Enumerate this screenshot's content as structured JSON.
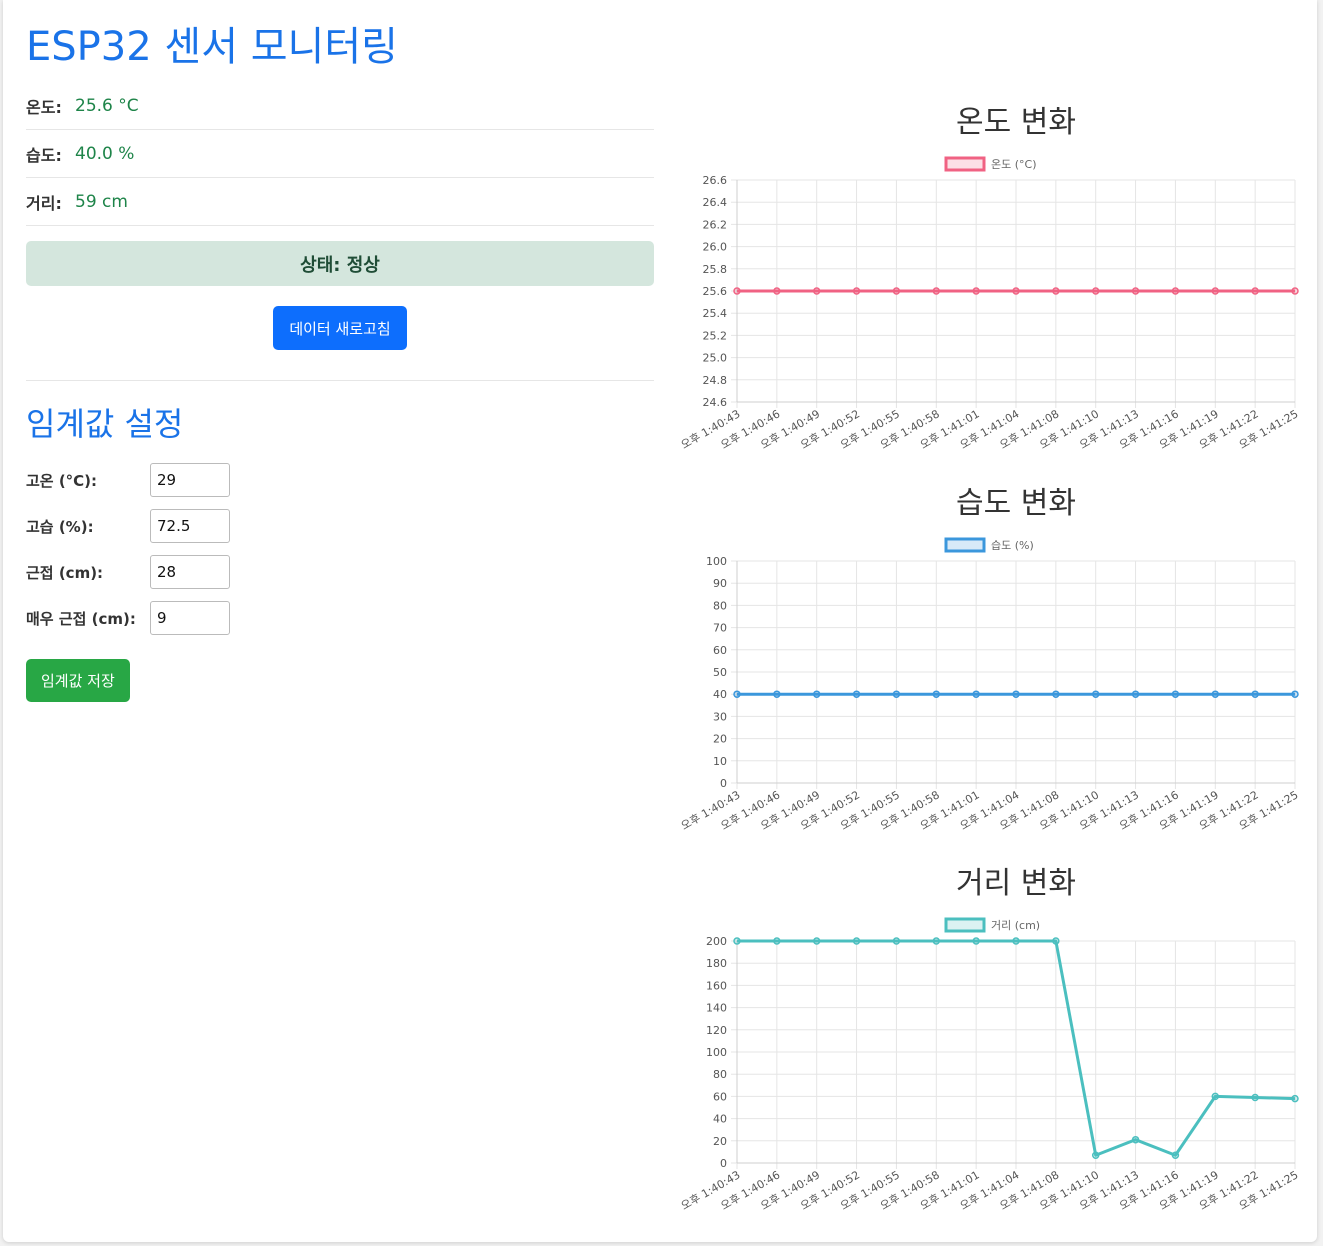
{
  "page": {
    "title": "ESP32 센서 모니터링"
  },
  "readings": [
    {
      "label": "온도:",
      "value": "25.6 °C"
    },
    {
      "label": "습도:",
      "value": "40.0 %"
    },
    {
      "label": "거리:",
      "value": "59 cm"
    }
  ],
  "status": {
    "text": "상태: 정상"
  },
  "actions": {
    "refresh_label": "데이터 새로고침"
  },
  "thresholds": {
    "heading": "임계값 설정",
    "fields": [
      {
        "label": "고온 (°C):",
        "value": "29"
      },
      {
        "label": "고습 (%):",
        "value": "72.5"
      },
      {
        "label": "근접 (cm):",
        "value": "28"
      },
      {
        "label": "매우 근접 (cm):",
        "value": "9"
      }
    ],
    "save_label": "임계값 저장"
  },
  "colors": {
    "temperature": "#f06283",
    "humidity": "#3b97dc",
    "distance": "#4bbfbf",
    "title": "#1a73e8"
  },
  "chart_data": [
    {
      "type": "line",
      "title": "온도 변화",
      "x": [
        "오후 1:40:43",
        "오후 1:40:46",
        "오후 1:40:49",
        "오후 1:40:52",
        "오후 1:40:55",
        "오후 1:40:58",
        "오후 1:41:01",
        "오후 1:41:04",
        "오후 1:41:08",
        "오후 1:41:10",
        "오후 1:41:13",
        "오후 1:41:16",
        "오후 1:41:19",
        "오후 1:41:22",
        "오후 1:41:25"
      ],
      "series": [
        {
          "name": "온도 (°C)",
          "color": "#f06283",
          "values": [
            25.6,
            25.6,
            25.6,
            25.6,
            25.6,
            25.6,
            25.6,
            25.6,
            25.6,
            25.6,
            25.6,
            25.6,
            25.6,
            25.6,
            25.6
          ]
        }
      ],
      "ylim": [
        24.6,
        26.6
      ],
      "yticks": [
        "26.6",
        "26.4",
        "26.2",
        "26.0",
        "25.8",
        "25.6",
        "25.4",
        "25.2",
        "25.0",
        "24.8",
        "24.6"
      ],
      "grid": true,
      "legend": "top"
    },
    {
      "type": "line",
      "title": "습도 변화",
      "x": [
        "오후 1:40:43",
        "오후 1:40:46",
        "오후 1:40:49",
        "오후 1:40:52",
        "오후 1:40:55",
        "오후 1:40:58",
        "오후 1:41:01",
        "오후 1:41:04",
        "오후 1:41:08",
        "오후 1:41:10",
        "오후 1:41:13",
        "오후 1:41:16",
        "오후 1:41:19",
        "오후 1:41:22",
        "오후 1:41:25"
      ],
      "series": [
        {
          "name": "습도 (%)",
          "color": "#3b97dc",
          "values": [
            40,
            40,
            40,
            40,
            40,
            40,
            40,
            40,
            40,
            40,
            40,
            40,
            40,
            40,
            40
          ]
        }
      ],
      "ylim": [
        0,
        100
      ],
      "yticks": [
        "100",
        "90",
        "80",
        "70",
        "60",
        "50",
        "40",
        "30",
        "20",
        "10",
        "0"
      ],
      "grid": true,
      "legend": "top"
    },
    {
      "type": "line",
      "title": "거리 변화",
      "x": [
        "오후 1:40:43",
        "오후 1:40:46",
        "오후 1:40:49",
        "오후 1:40:52",
        "오후 1:40:55",
        "오후 1:40:58",
        "오후 1:41:01",
        "오후 1:41:04",
        "오후 1:41:08",
        "오후 1:41:10",
        "오후 1:41:13",
        "오후 1:41:16",
        "오후 1:41:19",
        "오후 1:41:22",
        "오후 1:41:25"
      ],
      "series": [
        {
          "name": "거리 (cm)",
          "color": "#4bbfbf",
          "values": [
            200,
            200,
            200,
            200,
            200,
            200,
            200,
            200,
            200,
            7,
            21,
            7,
            60,
            59,
            58
          ]
        }
      ],
      "ylim": [
        0,
        200
      ],
      "yticks": [
        "200",
        "180",
        "160",
        "140",
        "120",
        "100",
        "80",
        "60",
        "40",
        "20",
        "0"
      ],
      "grid": true,
      "legend": "top"
    }
  ]
}
